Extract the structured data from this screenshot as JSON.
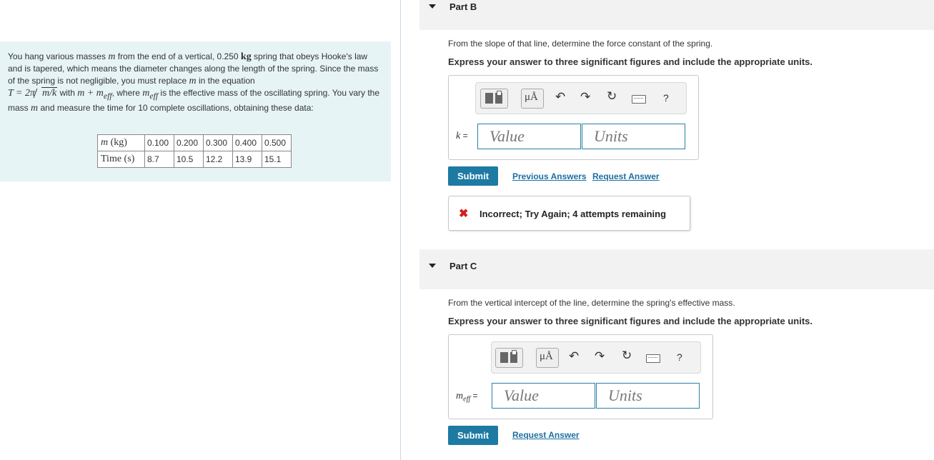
{
  "problem": {
    "p1": "You hang various masses",
    "m": "m",
    "p2": "from the end of a vertical, 0.250",
    "kg": "kg",
    "p3": "spring that obeys Hooke's law and is tapered, which means the diameter changes along the length of the spring. Since the mass of the spring is not negligible, you must replace",
    "p4": "in the equation",
    "eq_T": "T = 2π",
    "eq_sqrt": "m/k",
    "p5": "with",
    "eq_sum": "m + m",
    "eff": "eff",
    "p6": ", where",
    "p7": "is the effective mass of the oscillating spring. You vary the mass",
    "p8": "and measure the time for 10 complete oscillations, obtaining these data:",
    "table": {
      "row1_label_var": "m",
      "row1_label_unit": "(kg)",
      "row2_label": "Time (s)",
      "masses": [
        "0.100",
        "0.200",
        "0.300",
        "0.400",
        "0.500"
      ],
      "times": [
        "8.7",
        "10.5",
        "12.2",
        "13.9",
        "15.1"
      ]
    }
  },
  "partB": {
    "title": "Part B",
    "prompt": "From the slope of that line, determine the force constant of the spring.",
    "instruction": "Express your answer to three significant figures and include the appropriate units.",
    "var": "k",
    "eq": "=",
    "value_placeholder": "Value",
    "units_placeholder": "Units",
    "mu_label": "μÅ",
    "help_label": "?",
    "submit": "Submit",
    "prev_answers": "Previous Answers",
    "request_answer": "Request Answer",
    "feedback_icon": "✖",
    "feedback": "Incorrect; Try Again; 4 attempts remaining"
  },
  "partC": {
    "title": "Part C",
    "prompt": "From the vertical intercept of the line, determine the spring's effective mass.",
    "instruction": "Express your answer to three significant figures and include the appropriate units.",
    "var": "m",
    "var_sub": "eff",
    "eq": "=",
    "value_placeholder": "Value",
    "units_placeholder": "Units",
    "mu_label": "μÅ",
    "help_label": "?",
    "submit": "Submit",
    "request_answer": "Request Answer"
  },
  "icons": {
    "undo": "undo-icon",
    "redo": "redo-icon",
    "reset": "reset-icon",
    "keyboard": "keyboard-icon",
    "help": "help-icon",
    "templates": "templates-icon",
    "collapse": "caret-down-icon",
    "incorrect": "x-icon"
  },
  "colors": {
    "problem_bg": "#e6f4f5",
    "accent": "#1d7aa3",
    "input_border": "#2b7fa6",
    "error": "#d21f1f"
  }
}
